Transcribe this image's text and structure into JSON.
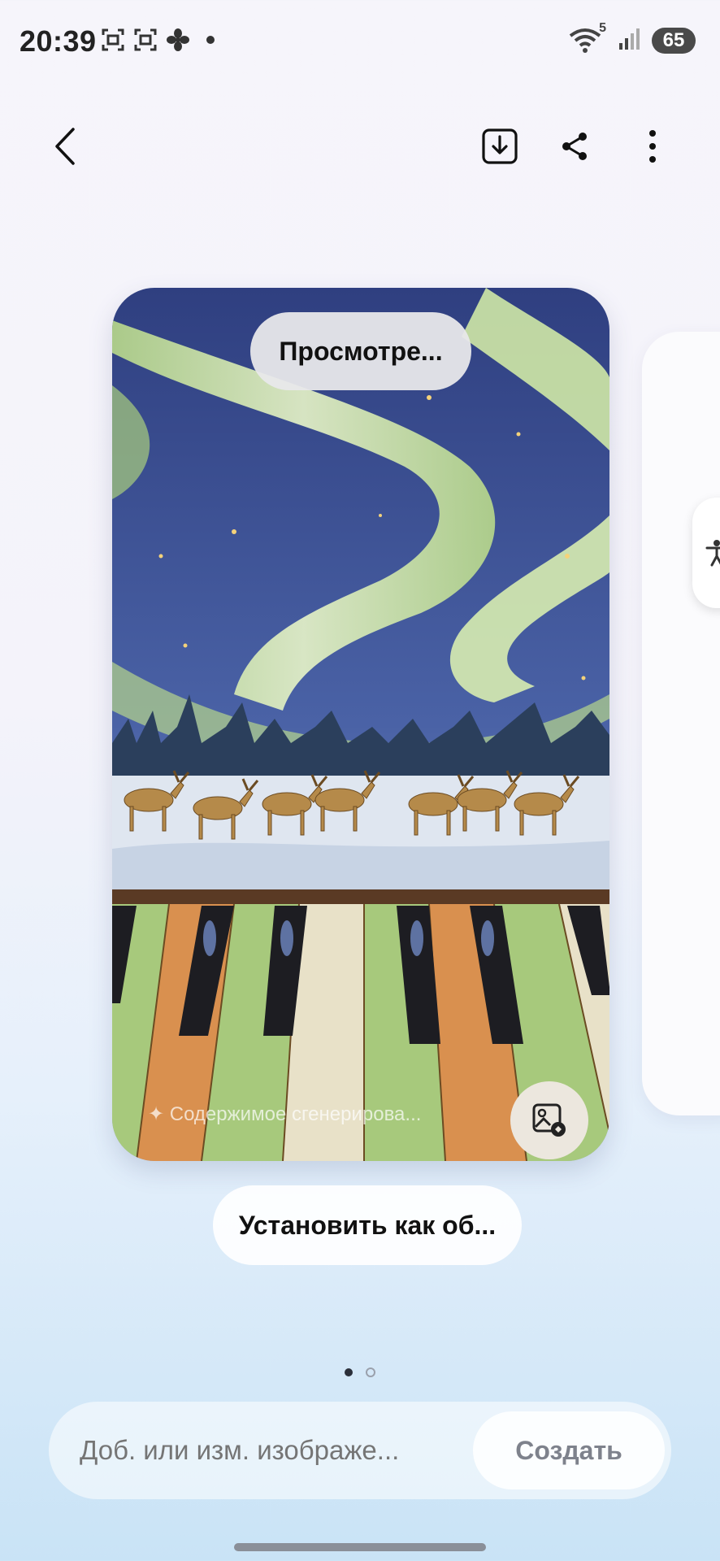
{
  "status_bar": {
    "time": "20:39",
    "left_icons": [
      "screenshot-icon",
      "screenshot-icon",
      "fan-icon",
      "dot-icon"
    ],
    "wifi_label": "5",
    "battery": "65"
  },
  "toolbar": {
    "back": "back-arrow-icon",
    "download": "download-icon",
    "share": "share-icon",
    "more": "more-vertical-icon"
  },
  "preview": {
    "top_pill": "Просмотре...",
    "caption": "✦ Содержимое сгенерирова...",
    "edit_icon": "image-edit-icon"
  },
  "actions": {
    "set_as": "Установить как об..."
  },
  "pagination": {
    "count": 2,
    "active_index": 0
  },
  "composer": {
    "placeholder": "Доб. или изм. изображе...",
    "create": "Создать"
  },
  "colors": {
    "sky": "#3f5596",
    "aurora": "#d9efb5",
    "snow": "#dfe6f0",
    "key_green": "#a7c97c",
    "key_orange": "#d9904f"
  }
}
